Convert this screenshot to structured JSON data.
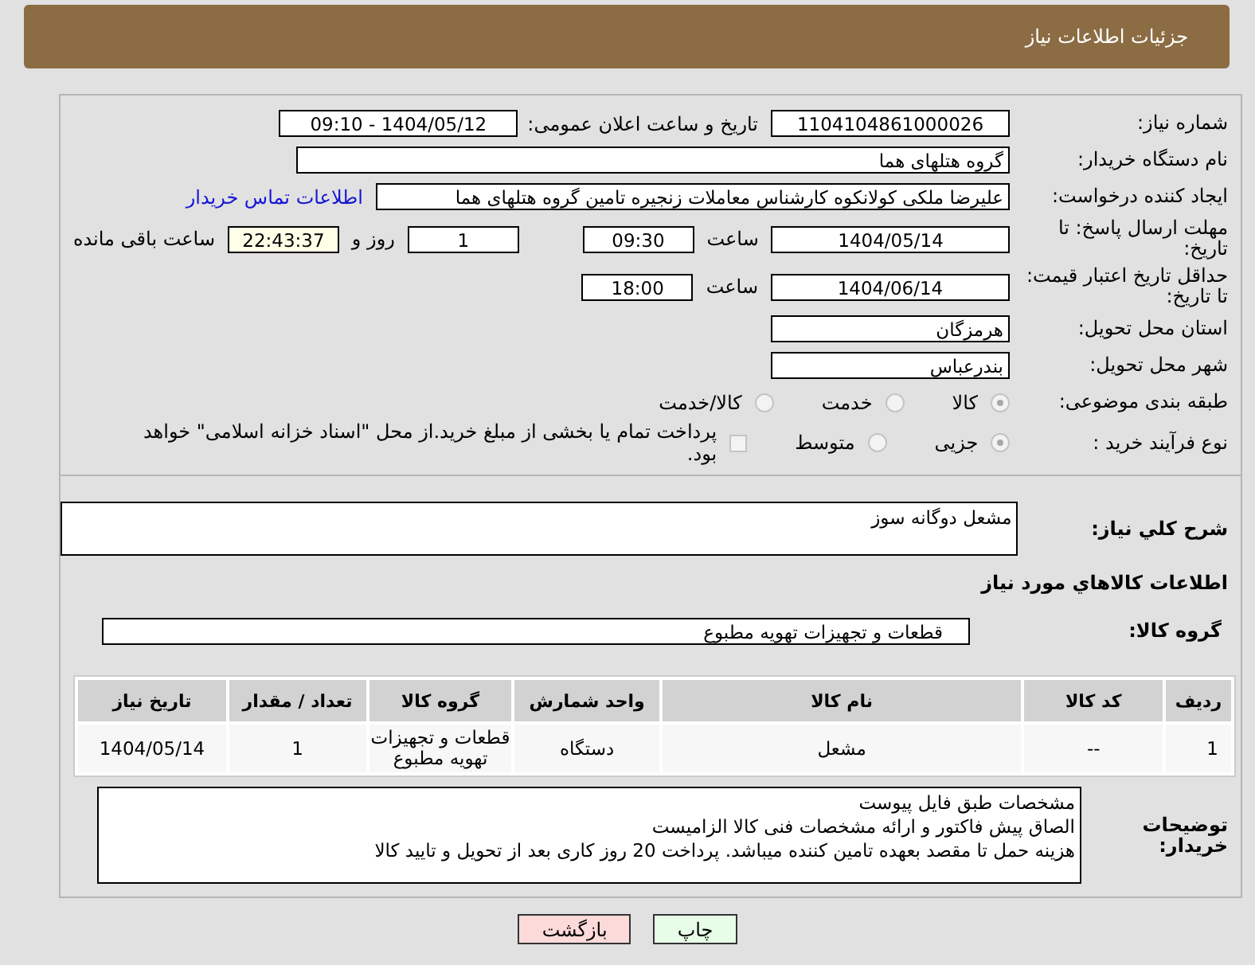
{
  "header": {
    "title": "جزئیات اطلاعات نیاز"
  },
  "need_number": {
    "label": "شماره نیاز:",
    "value": "1104104861000026"
  },
  "announce": {
    "label": "تاریخ و ساعت اعلان عمومی:",
    "value": "1404/05/12 - 09:10"
  },
  "buyer": {
    "label": "نام دستگاه خریدار:",
    "value": "گروه هتلهای هما"
  },
  "creator": {
    "label": "ایجاد کننده درخواست:",
    "value": "علیرضا ملکی کولانکوه کارشناس معاملات زنجیره تامین گروه هتلهای هما",
    "link": "اطلاعات تماس خریدار"
  },
  "deadline": {
    "label": "مهلت ارسال پاسخ: تا تاریخ:",
    "date": "1404/05/14",
    "time_label": "ساعت",
    "time": "09:30",
    "days": "1",
    "days_label": "روز و",
    "remaining": "22:43:37",
    "remaining_label": "ساعت باقی مانده"
  },
  "validity": {
    "label": "حداقل تاریخ اعتبار قیمت: تا تاریخ:",
    "date": "1404/06/14",
    "time_label": "ساعت",
    "time": "18:00"
  },
  "province": {
    "label": "استان محل تحویل:",
    "value": "هرمزگان"
  },
  "city": {
    "label": "شهر محل تحویل:",
    "value": "بندرعباس"
  },
  "category": {
    "label": "طبقه بندی موضوعی:",
    "options": [
      {
        "label": "کالا",
        "selected": true
      },
      {
        "label": "خدمت",
        "selected": false
      },
      {
        "label": "کالا/خدمت",
        "selected": false
      }
    ]
  },
  "process": {
    "label": "نوع فرآیند خرید :",
    "options": [
      {
        "label": "جزیی",
        "selected": true
      },
      {
        "label": "متوسط",
        "selected": false
      }
    ],
    "payment": {
      "label": "پرداخت تمام یا بخشی از مبلغ خرید.از محل \"اسناد خزانه اسلامی\" خواهد بود.",
      "checked": false
    }
  },
  "description": {
    "label": "شرح كلي نياز:",
    "value": "مشعل دوگانه سوز"
  },
  "goods_title": "اطلاعات كالاهاي مورد نياز",
  "goods_group": {
    "label": "گروه کالا:",
    "value": "قطعات و تجهیزات تهویه مطبوع"
  },
  "table": {
    "columns": [
      "ردیف",
      "کد کالا",
      "نام کالا",
      "واحد شمارش",
      "گروه کالا",
      "تعداد / مقدار",
      "تاریخ نیاز"
    ],
    "rows": [
      [
        "1",
        "--",
        "مشعل",
        "دستگاه",
        "قطعات و تجهیزات تهویه مطبوع",
        "1",
        "1404/05/14"
      ]
    ]
  },
  "notes": {
    "label": "توضیحات خریدار:",
    "lines": [
      "مشخصات طبق فایل پیوست",
      "الصاق پیش فاکتور و ارائه مشخصات فنی کالا الزامیست",
      "هزینه حمل تا مقصد بعهده تامین کننده میباشد. پرداخت 20 روز کاری بعد از تحویل و تایید کالا"
    ]
  },
  "buttons": [
    {
      "label": "چاپ",
      "kind": "print"
    },
    {
      "label": "بازگشت",
      "kind": "back"
    }
  ]
}
